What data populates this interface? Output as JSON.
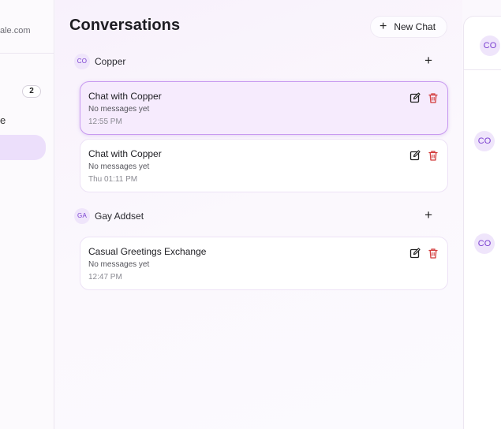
{
  "sidebar": {
    "email_fragment": "ale.com",
    "count_badge": "2",
    "item_fragment": "e"
  },
  "main": {
    "title": "Conversations",
    "new_chat_label": "New Chat",
    "new_chat_icon": "+",
    "groups": [
      {
        "initials": "CO",
        "name": "Copper",
        "add_icon": "+",
        "chats": [
          {
            "title": "Chat with Copper",
            "subtitle": "No messages yet",
            "time": "12:55 PM",
            "active": true
          },
          {
            "title": "Chat with Copper",
            "subtitle": "No messages yet",
            "time": "Thu 01:11 PM",
            "active": false
          }
        ]
      },
      {
        "initials": "GA",
        "name": "Gay Addset",
        "add_icon": "+",
        "chats": [
          {
            "title": "Casual Greetings Exchange",
            "subtitle": "No messages yet",
            "time": "12:47 PM",
            "active": false
          }
        ]
      }
    ]
  },
  "right_panel": {
    "header_avatar": "CO",
    "message_avatars": [
      "CO",
      "CO"
    ]
  },
  "colors": {
    "accent": "#7a3fd0",
    "active_card_bg": "#f6ebfd",
    "active_card_border": "#c89af0",
    "delete_red": "#d23a3a"
  }
}
